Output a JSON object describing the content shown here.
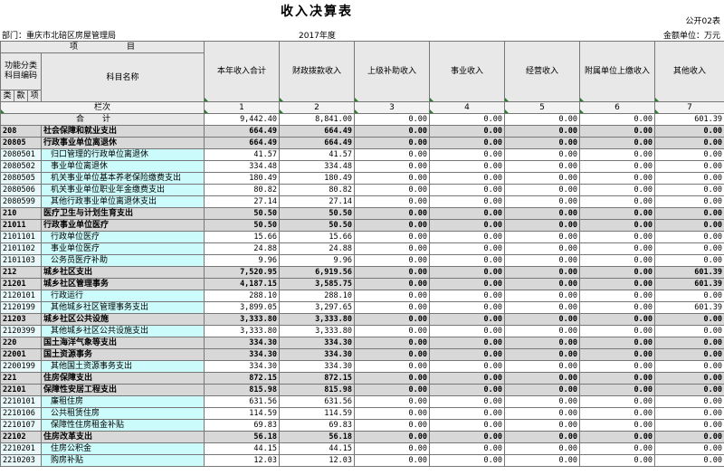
{
  "header": {
    "title": "收入决算表",
    "form_no": "公开02表",
    "department": "部门：重庆市北碚区房屋管理局",
    "year": "2017年度",
    "unit": "金额单位：万元"
  },
  "table_head": {
    "item_label": "项　　　　　　目",
    "func_class_code": "功能分类科目编码",
    "subject_name": "科目名称",
    "lei": "类",
    "kuan": "款",
    "xiang": "项",
    "column_order": "栏次",
    "columns": [
      "本年收入合计",
      "财政拨款收入",
      "上级补助收入",
      "事业收入",
      "经营收入",
      "附属单位上缴收入",
      "其他收入"
    ],
    "column_numbers": [
      "1",
      "2",
      "3",
      "4",
      "5",
      "6",
      "7"
    ]
  },
  "total_row": {
    "label": "合计",
    "values": [
      "9,442.40",
      "8,841.00",
      "0.00",
      "0.00",
      "0.00",
      "0.00",
      "601.39"
    ]
  },
  "rows": [
    {
      "code": "208",
      "name": "社会保障和就业支出",
      "bold": true,
      "values": [
        "664.49",
        "664.49",
        "0.00",
        "0.00",
        "0.00",
        "0.00",
        "0.00"
      ]
    },
    {
      "code": "20805",
      "name": "行政事业单位离退休",
      "bold": true,
      "values": [
        "664.49",
        "664.49",
        "0.00",
        "0.00",
        "0.00",
        "0.00",
        "0.00"
      ]
    },
    {
      "code": "2080501",
      "name": "归口管理的行政单位离退休",
      "bold": false,
      "values": [
        "41.57",
        "41.57",
        "0.00",
        "0.00",
        "0.00",
        "0.00",
        "0.00"
      ]
    },
    {
      "code": "2080502",
      "name": "事业单位离退休",
      "bold": false,
      "values": [
        "334.48",
        "334.48",
        "0.00",
        "0.00",
        "0.00",
        "0.00",
        "0.00"
      ]
    },
    {
      "code": "2080505",
      "name": "机关事业单位基本养老保险缴费支出",
      "bold": false,
      "values": [
        "180.49",
        "180.49",
        "0.00",
        "0.00",
        "0.00",
        "0.00",
        "0.00"
      ]
    },
    {
      "code": "2080506",
      "name": "机关事业单位职业年金缴费支出",
      "bold": false,
      "values": [
        "80.82",
        "80.82",
        "0.00",
        "0.00",
        "0.00",
        "0.00",
        "0.00"
      ]
    },
    {
      "code": "2080599",
      "name": "其他行政事业单位离退休支出",
      "bold": false,
      "values": [
        "27.14",
        "27.14",
        "0.00",
        "0.00",
        "0.00",
        "0.00",
        "0.00"
      ]
    },
    {
      "code": "210",
      "name": "医疗卫生与计划生育支出",
      "bold": true,
      "values": [
        "50.50",
        "50.50",
        "0.00",
        "0.00",
        "0.00",
        "0.00",
        "0.00"
      ]
    },
    {
      "code": "21011",
      "name": "行政事业单位医疗",
      "bold": true,
      "values": [
        "50.50",
        "50.50",
        "0.00",
        "0.00",
        "0.00",
        "0.00",
        "0.00"
      ]
    },
    {
      "code": "2101101",
      "name": "行政单位医疗",
      "bold": false,
      "values": [
        "15.66",
        "15.66",
        "0.00",
        "0.00",
        "0.00",
        "0.00",
        "0.00"
      ]
    },
    {
      "code": "2101102",
      "name": "事业单位医疗",
      "bold": false,
      "values": [
        "24.88",
        "24.88",
        "0.00",
        "0.00",
        "0.00",
        "0.00",
        "0.00"
      ]
    },
    {
      "code": "2101103",
      "name": "公务员医疗补助",
      "bold": false,
      "values": [
        "9.96",
        "9.96",
        "0.00",
        "0.00",
        "0.00",
        "0.00",
        "0.00"
      ]
    },
    {
      "code": "212",
      "name": "城乡社区支出",
      "bold": true,
      "values": [
        "7,520.95",
        "6,919.56",
        "0.00",
        "0.00",
        "0.00",
        "0.00",
        "601.39"
      ]
    },
    {
      "code": "21201",
      "name": "城乡社区管理事务",
      "bold": true,
      "values": [
        "4,187.15",
        "3,585.75",
        "0.00",
        "0.00",
        "0.00",
        "0.00",
        "601.39"
      ]
    },
    {
      "code": "2120101",
      "name": "行政运行",
      "bold": false,
      "values": [
        "288.10",
        "288.10",
        "0.00",
        "0.00",
        "0.00",
        "0.00",
        "0.00"
      ]
    },
    {
      "code": "2120199",
      "name": "其他城乡社区管理事务支出",
      "bold": false,
      "values": [
        "3,899.05",
        "3,297.65",
        "0.00",
        "0.00",
        "0.00",
        "0.00",
        "601.39"
      ]
    },
    {
      "code": "21203",
      "name": "城乡社区公共设施",
      "bold": true,
      "values": [
        "3,333.80",
        "3,333.80",
        "0.00",
        "0.00",
        "0.00",
        "0.00",
        "0.00"
      ]
    },
    {
      "code": "2120399",
      "name": "其他城乡社区公共设施支出",
      "bold": false,
      "values": [
        "3,333.80",
        "3,333.80",
        "0.00",
        "0.00",
        "0.00",
        "0.00",
        "0.00"
      ]
    },
    {
      "code": "220",
      "name": "国土海洋气象等支出",
      "bold": true,
      "values": [
        "334.30",
        "334.30",
        "0.00",
        "0.00",
        "0.00",
        "0.00",
        "0.00"
      ]
    },
    {
      "code": "22001",
      "name": "国土资源事务",
      "bold": true,
      "values": [
        "334.30",
        "334.30",
        "0.00",
        "0.00",
        "0.00",
        "0.00",
        "0.00"
      ]
    },
    {
      "code": "2200199",
      "name": "其他国土资源事务支出",
      "bold": false,
      "values": [
        "334.30",
        "334.30",
        "0.00",
        "0.00",
        "0.00",
        "0.00",
        "0.00"
      ]
    },
    {
      "code": "221",
      "name": "住房保障支出",
      "bold": true,
      "values": [
        "872.15",
        "872.15",
        "0.00",
        "0.00",
        "0.00",
        "0.00",
        "0.00"
      ]
    },
    {
      "code": "22101",
      "name": "保障性安居工程支出",
      "bold": true,
      "values": [
        "815.98",
        "815.98",
        "0.00",
        "0.00",
        "0.00",
        "0.00",
        "0.00"
      ]
    },
    {
      "code": "2210101",
      "name": "廉租住房",
      "bold": false,
      "values": [
        "631.56",
        "631.56",
        "0.00",
        "0.00",
        "0.00",
        "0.00",
        "0.00"
      ]
    },
    {
      "code": "2210106",
      "name": "公共租赁住房",
      "bold": false,
      "values": [
        "114.59",
        "114.59",
        "0.00",
        "0.00",
        "0.00",
        "0.00",
        "0.00"
      ]
    },
    {
      "code": "2210107",
      "name": "保障性住房租金补贴",
      "bold": false,
      "values": [
        "69.83",
        "69.83",
        "0.00",
        "0.00",
        "0.00",
        "0.00",
        "0.00"
      ]
    },
    {
      "code": "22102",
      "name": "住房改革支出",
      "bold": true,
      "values": [
        "56.18",
        "56.18",
        "0.00",
        "0.00",
        "0.00",
        "0.00",
        "0.00"
      ]
    },
    {
      "code": "2210201",
      "name": "住房公积金",
      "bold": false,
      "values": [
        "44.15",
        "44.15",
        "0.00",
        "0.00",
        "0.00",
        "0.00",
        "0.00"
      ]
    },
    {
      "code": "2210203",
      "name": "购房补贴",
      "bold": false,
      "values": [
        "12.03",
        "12.03",
        "0.00",
        "0.00",
        "0.00",
        "0.00",
        "0.00"
      ]
    }
  ]
}
